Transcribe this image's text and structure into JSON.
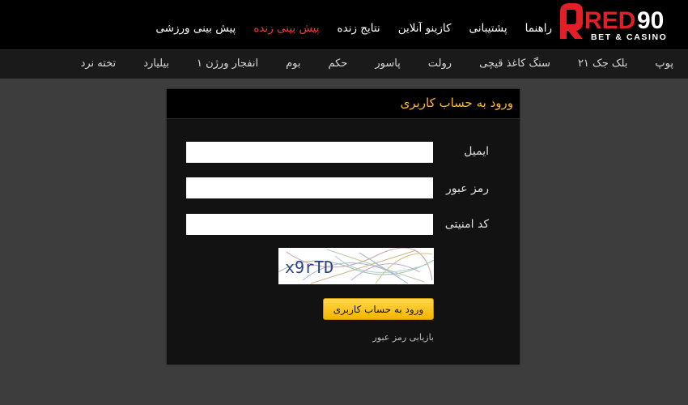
{
  "logo": {
    "brand": "RED90",
    "tagline": "BET & CASINO",
    "icon": "red-shield-logo-icon",
    "brand_color": "#e21f26"
  },
  "top_nav": {
    "items": [
      {
        "label": "پیش بینی ورزشی",
        "active": false
      },
      {
        "label": "پیش بینی زنده",
        "active": true
      },
      {
        "label": "نتایج زنده",
        "active": false
      },
      {
        "label": "کازینو آنلاین",
        "active": false
      },
      {
        "label": "پشتیبانی",
        "active": false
      },
      {
        "label": "راهنما",
        "active": false
      }
    ]
  },
  "game_nav": {
    "items": [
      {
        "label": "تخته نرد"
      },
      {
        "label": "بیلیارد"
      },
      {
        "label": "انفجار ورژن ۱"
      },
      {
        "label": "بوم"
      },
      {
        "label": "حکم"
      },
      {
        "label": "پاسور"
      },
      {
        "label": "رولت"
      },
      {
        "label": "سنگ کاغذ قیچی"
      },
      {
        "label": "بلک جک ۲۱"
      },
      {
        "label": "پوپ"
      }
    ]
  },
  "login": {
    "title": "ورود به حساب کاربری",
    "email_label": "ایمیل",
    "email_value": "",
    "password_label": "رمز عبور",
    "password_value": "",
    "security_code_label": "کد امنیتی",
    "security_code_value": "",
    "captcha_text": "x9rTD",
    "submit_label": "ورود به حساب کاربری",
    "forgot_label": "بازیابی رمز عبور",
    "accent_color": "#f7b731"
  }
}
